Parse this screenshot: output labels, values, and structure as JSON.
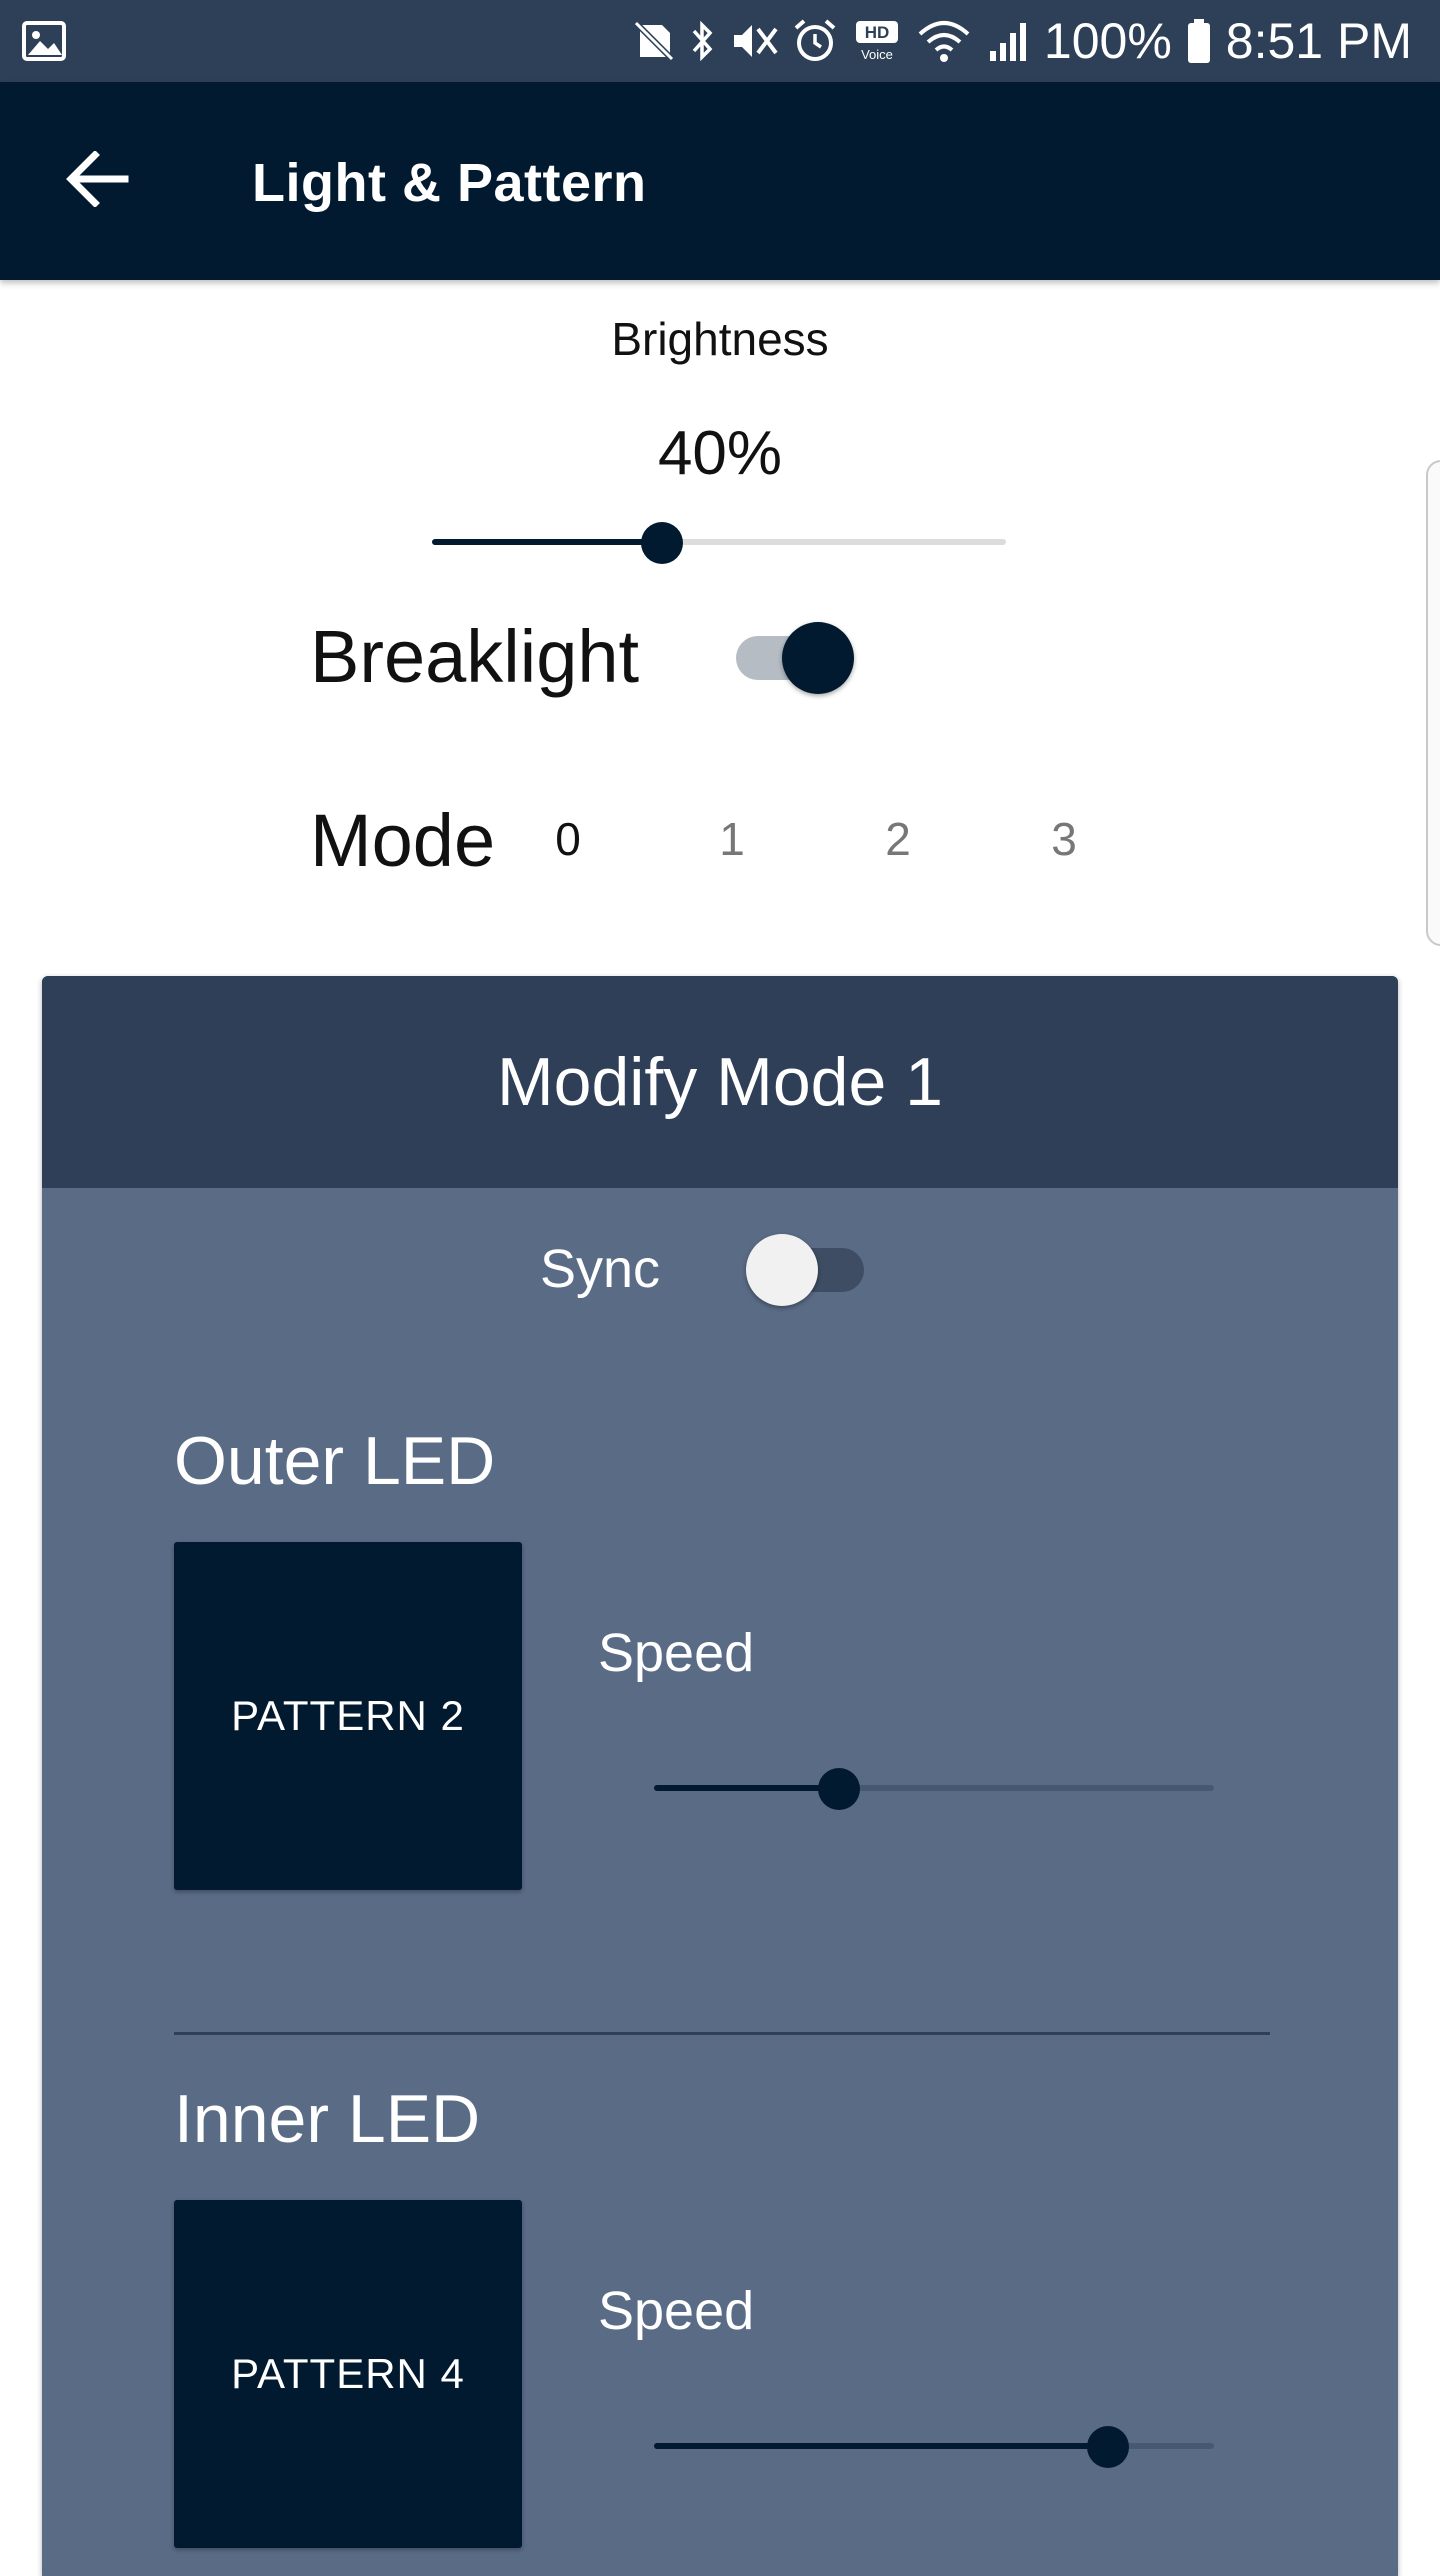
{
  "status_bar": {
    "battery": "100%",
    "time": "8:51 PM",
    "icons": [
      "image-icon",
      "no-sim-icon",
      "bluetooth-icon",
      "mute-icon",
      "alarm-icon",
      "hd-voice-icon",
      "wifi-icon",
      "signal-icon",
      "battery-icon"
    ]
  },
  "app_bar": {
    "title": "Light & Pattern",
    "back_icon": "arrow-left-icon"
  },
  "brightness": {
    "label": "Brightness",
    "value_text": "40%",
    "value": 40
  },
  "breaklight": {
    "label": "Breaklight",
    "on": true
  },
  "mode": {
    "label": "Mode",
    "options": [
      "0",
      "1",
      "2",
      "3"
    ],
    "selected": "0"
  },
  "modify_panel": {
    "title": "Modify Mode 1",
    "sync": {
      "label": "Sync",
      "on": false
    },
    "outer": {
      "title": "Outer LED",
      "pattern_label": "PATTERN 2",
      "speed_label": "Speed",
      "speed": 33
    },
    "inner": {
      "title": "Inner LED",
      "pattern_label": "PATTERN 4",
      "speed_label": "Speed",
      "speed": 81
    }
  },
  "colors": {
    "primary_dark": "#021a30",
    "panel_bg": "#5a6b86",
    "panel_header": "#2e3f57",
    "status_bar": "#2e4057"
  }
}
